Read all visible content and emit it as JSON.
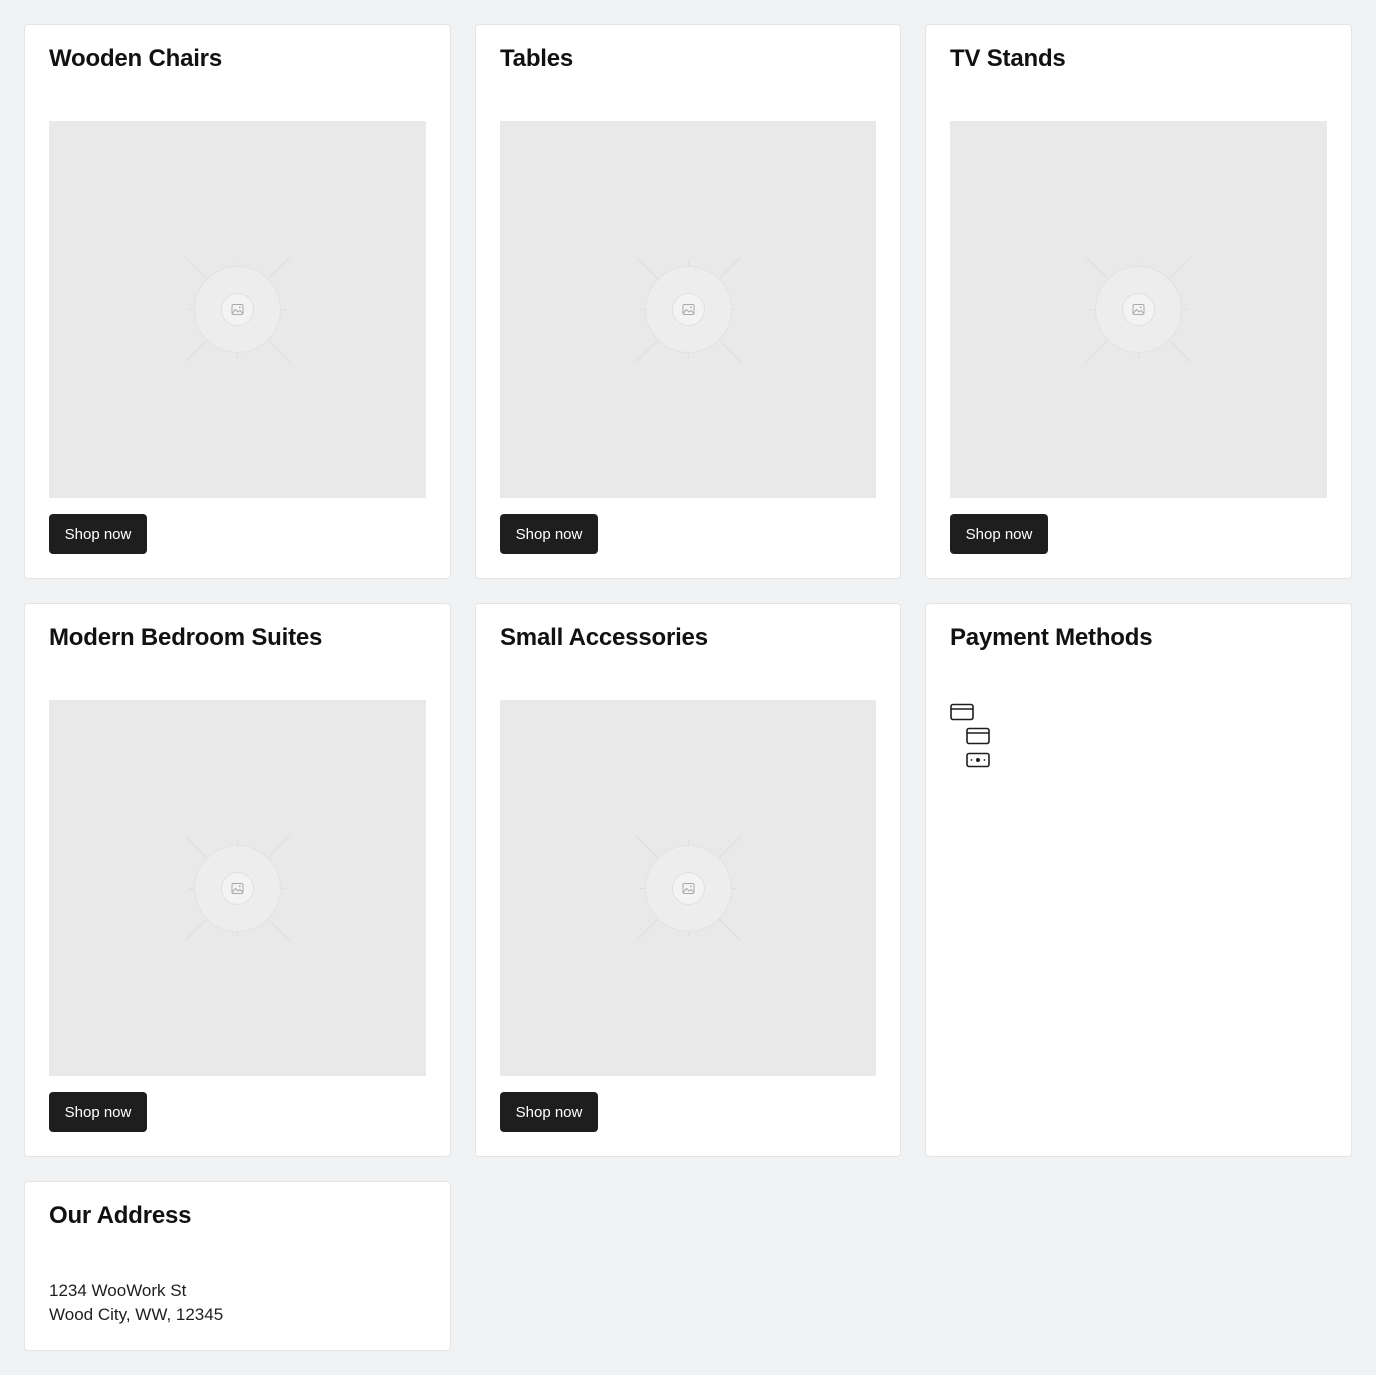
{
  "cards": [
    {
      "title": "Wooden Chairs",
      "button_label": "Shop now"
    },
    {
      "title": "Tables",
      "button_label": "Shop now"
    },
    {
      "title": "TV Stands",
      "button_label": "Shop now"
    },
    {
      "title": "Modern Bedroom Suites",
      "button_label": "Shop now"
    },
    {
      "title": "Small Accessories",
      "button_label": "Shop now"
    }
  ],
  "payment": {
    "title": "Payment Methods",
    "icons": [
      "credit-card-icon",
      "credit-card-icon",
      "cash-icon"
    ]
  },
  "address": {
    "title": "Our Address",
    "line1": "1234 WooWork St",
    "line2": "Wood City, WW, 12345"
  },
  "colors": {
    "page_background": "#f1f2f4",
    "card_background": "#ffffff",
    "placeholder": "#e9e9e9",
    "button": "#1e1e1e",
    "button_text": "#ffffff"
  }
}
